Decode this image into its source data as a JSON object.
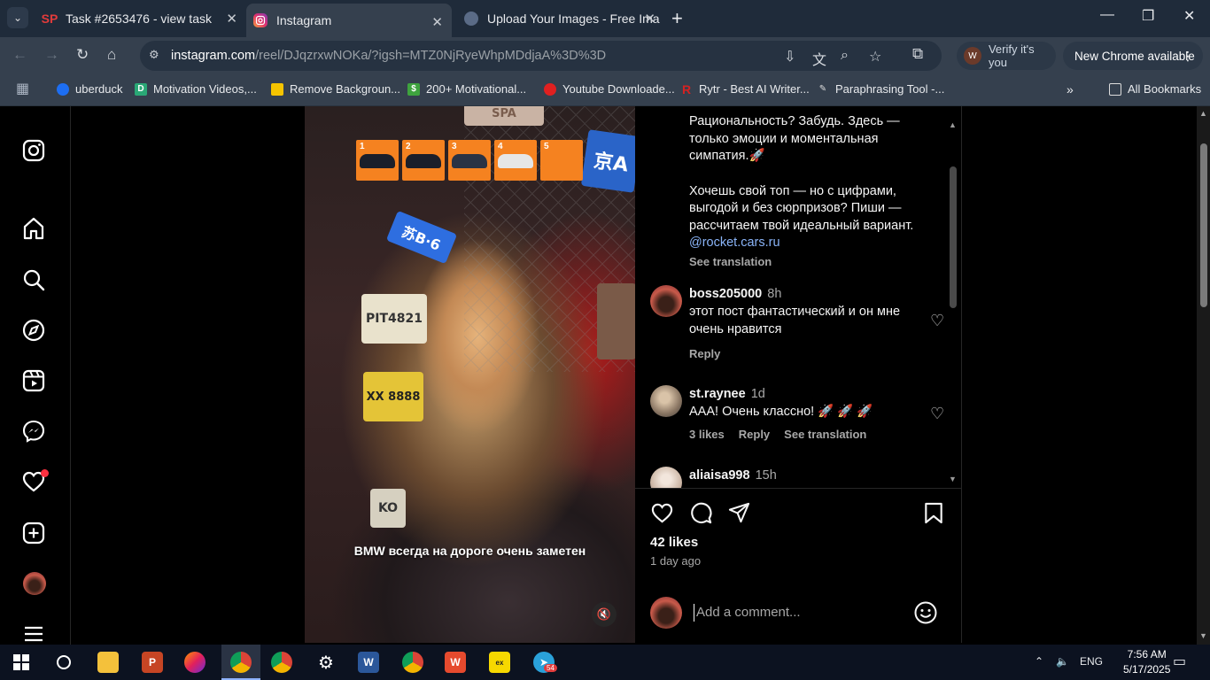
{
  "browser": {
    "tabs": [
      {
        "title": "Task #2653476 - view task",
        "favicon": "SP"
      },
      {
        "title": "Instagram",
        "favicon": "instagram-icon"
      },
      {
        "title": "Upload Your Images - Free Ima",
        "favicon": "upload-icon"
      }
    ],
    "url_host": "instagram.com",
    "url_path": "/reel/DJqzrxwNOKa/?igsh=MTZ0NjRyeWhpMDdjaA%3D%3D",
    "verify_label": "Verify it's you",
    "new_chrome_label": "New Chrome available",
    "bookmarks": [
      {
        "label": "uberduck",
        "color": "#1d6ef2"
      },
      {
        "label": "Motivation Videos,...",
        "color": "#2aa876"
      },
      {
        "label": "Remove Backgroun...",
        "color": "#f5c400"
      },
      {
        "label": "200+ Motivational...",
        "color": "#3ea33e"
      },
      {
        "label": "Youtube Downloade...",
        "color": "#e02020"
      },
      {
        "label": "Rytr - Best AI Writer...",
        "color": "#d42222"
      },
      {
        "label": "Paraphrasing Tool -...",
        "color": "#444444"
      }
    ],
    "all_bookmarks": "All Bookmarks"
  },
  "reel": {
    "thumb_numbers": [
      "1",
      "2",
      "3",
      "4",
      "5"
    ],
    "caption": "BMW всегда на дороге очень заметен",
    "plates": [
      "SPA",
      "京A",
      "苏B·6",
      "PIT4821",
      "XX 8888",
      "KO"
    ]
  },
  "post": {
    "description_lines": [
      "Рациональность? Забудь. Здесь —",
      "только эмоции и моментальная",
      "симпатия.🚀"
    ],
    "description_lines2": [
      "Хочешь свой топ — но с цифрами,",
      "выгодой и без сюрпризов? Пиши —",
      "рассчитаем твой идеальный вариант."
    ],
    "mention": "@rocket.cars.ru",
    "see_translation": "See translation",
    "comments": [
      {
        "user": "boss205000",
        "time": "8h",
        "text": "этот пост фантастический и он мне очень нравится",
        "meta": [
          "Reply"
        ]
      },
      {
        "user": "st.raynee",
        "time": "1d",
        "text": "ААА! Очень классно! 🚀 🚀 🚀",
        "meta": [
          "3 likes",
          "Reply",
          "See translation"
        ]
      },
      {
        "user": "aliaisa998",
        "time": "15h",
        "text": "",
        "meta": []
      }
    ],
    "likes": "42 likes",
    "ago": "1 day ago",
    "add_comment_placeholder": "Add a comment..."
  },
  "taskbar": {
    "lang": "ENG",
    "time": "7:56 AM",
    "date": "5/17/2025",
    "telegram_badge": "54"
  }
}
